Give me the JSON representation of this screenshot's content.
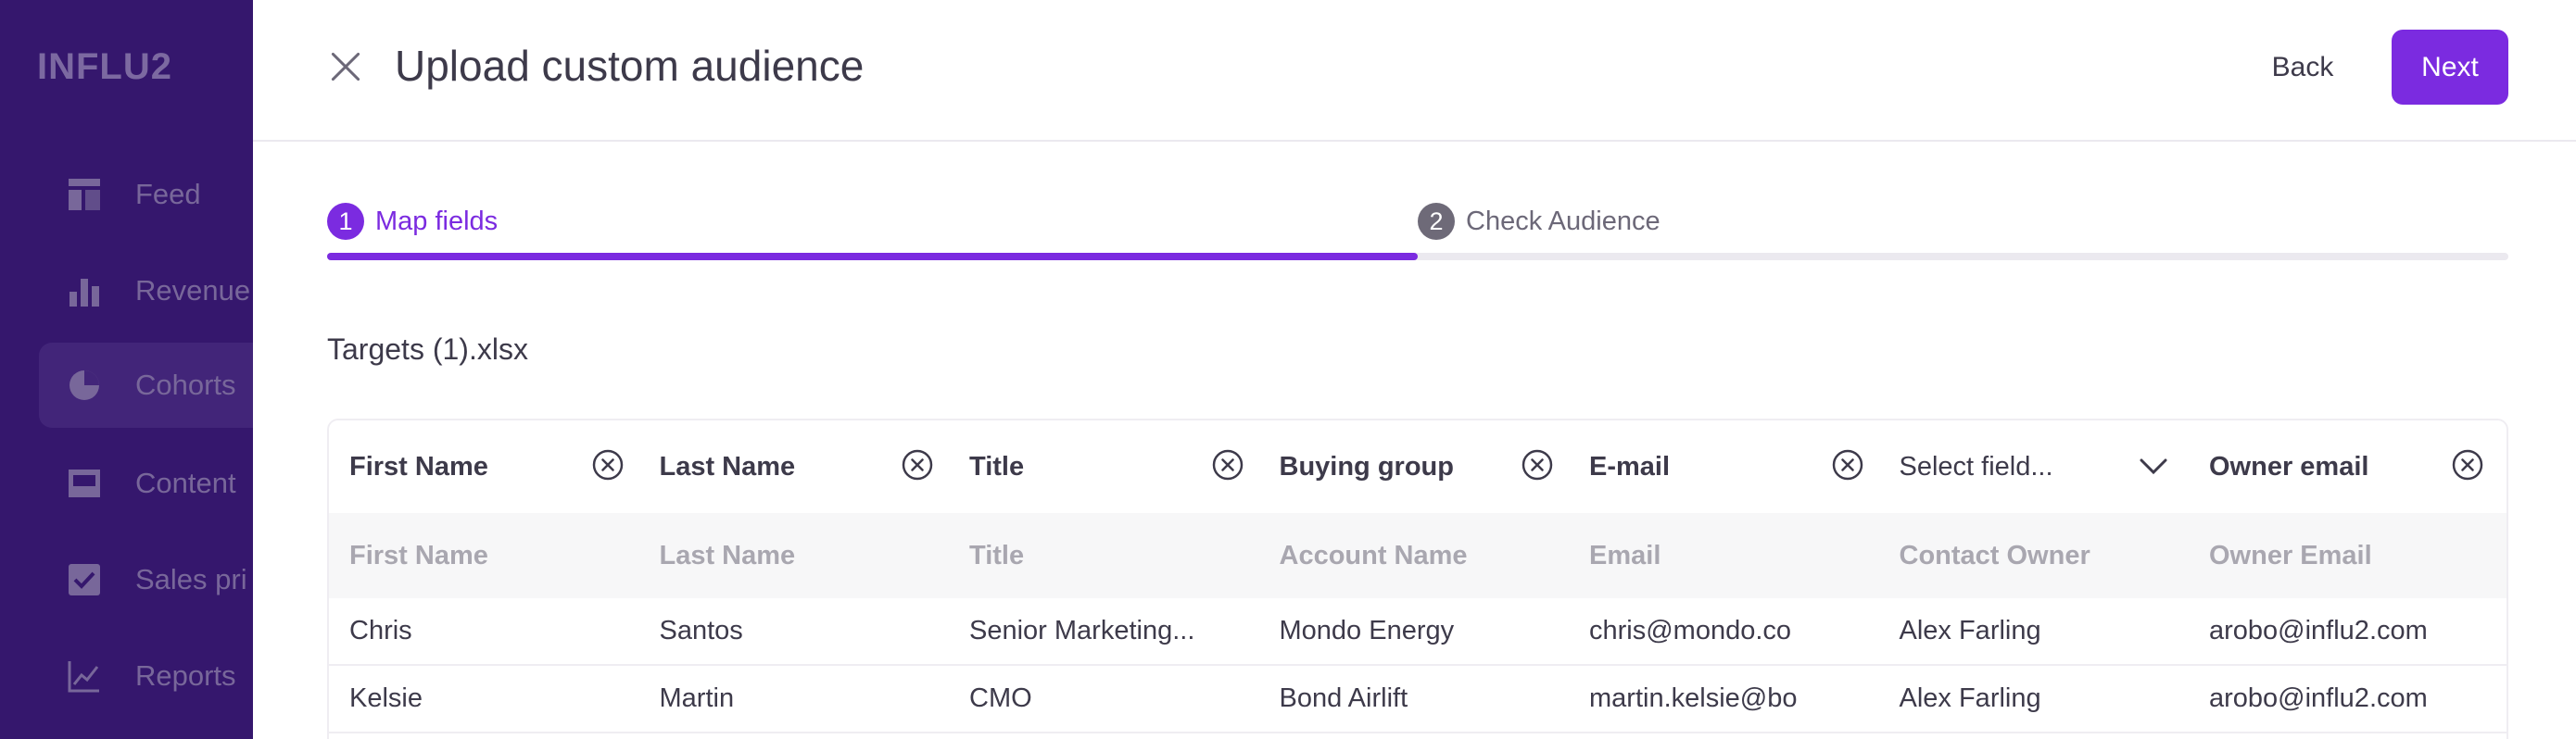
{
  "app": {
    "logo": "INFLU2"
  },
  "sidebar": {
    "items": [
      {
        "label": "Feed",
        "icon": "feed-icon"
      },
      {
        "label": "Revenue",
        "icon": "bar-chart-icon"
      },
      {
        "label": "Cohorts",
        "icon": "pie-chart-icon",
        "active": true
      },
      {
        "label": "Content",
        "icon": "content-icon"
      },
      {
        "label": "Sales pri",
        "icon": "checkbox-icon"
      },
      {
        "label": "Reports",
        "icon": "line-chart-icon"
      }
    ]
  },
  "modal": {
    "title": "Upload custom audience",
    "back_label": "Back",
    "next_label": "Next",
    "accent": "#7b2be0"
  },
  "stepper": {
    "steps": [
      {
        "number": "1",
        "label": "Map fields",
        "active": true
      },
      {
        "number": "2",
        "label": "Check Audience",
        "active": false
      }
    ],
    "progress": 0.5
  },
  "file": {
    "name": "Targets (1).xlsx"
  },
  "table": {
    "mapped_headers": [
      "First Name",
      "Last Name",
      "Title",
      "Buying group",
      "E-mail",
      "Select field...",
      "Owner email"
    ],
    "source_headers": [
      "First Name",
      "Last Name",
      "Title",
      "Account Name",
      "Email",
      "Contact Owner",
      "Owner Email"
    ],
    "rows": [
      [
        "Chris",
        "Santos",
        "Senior Marketing...",
        "Mondo Energy",
        "chris@mondo.co",
        "Alex Farling",
        "arobo@influ2.com"
      ],
      [
        "Kelsie",
        "Martin",
        "CMO",
        "Bond Airlift",
        "martin.kelsie@bo",
        "Alex Farling",
        "arobo@influ2.com"
      ]
    ]
  }
}
